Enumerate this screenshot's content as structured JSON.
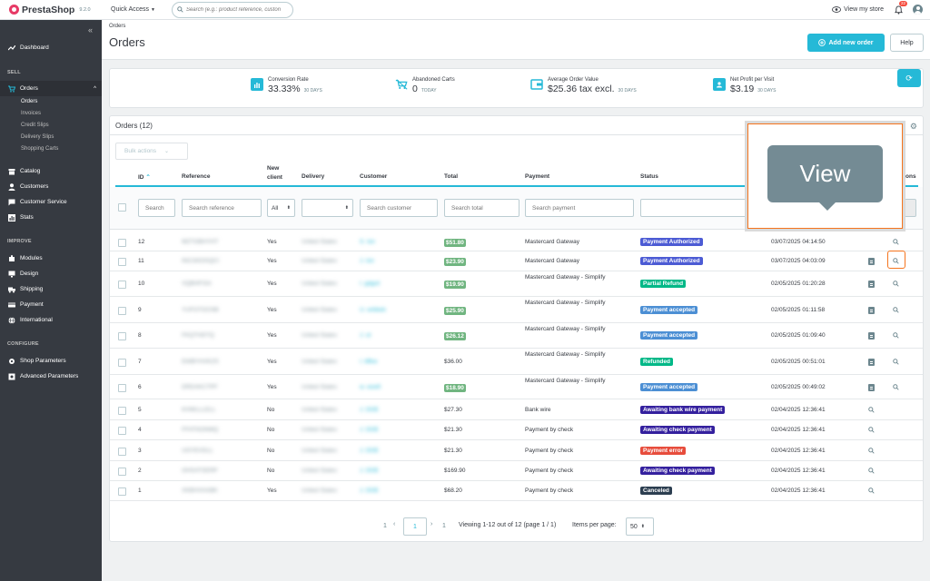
{
  "app": {
    "name": "PrestaShop",
    "version": "9.2.0",
    "quick_access": "Quick Access",
    "search_placeholder": "Search (e.g.: product reference, custon",
    "view_store": "View my store",
    "notifications": "22"
  },
  "sidebar": {
    "dashboard": "Dashboard",
    "section_sell": "SELL",
    "orders": "Orders",
    "orders_sub": [
      "Orders",
      "Invoices",
      "Credit Slips",
      "Delivery Slips",
      "Shopping Carts"
    ],
    "catalog": "Catalog",
    "customers": "Customers",
    "customer_service": "Customer Service",
    "stats": "Stats",
    "section_improve": "IMPROVE",
    "modules": "Modules",
    "design": "Design",
    "shipping": "Shipping",
    "payment": "Payment",
    "international": "International",
    "section_configure": "CONFIGURE",
    "shop_parameters": "Shop Parameters",
    "advanced_parameters": "Advanced Parameters"
  },
  "header": {
    "breadcrumb": "Orders",
    "title": "Orders",
    "add_button": "Add new order",
    "help_button": "Help"
  },
  "kpi": [
    {
      "label": "Conversion Rate",
      "value": "33.33%",
      "sub": "30 DAYS"
    },
    {
      "label": "Abandoned Carts",
      "value": "0",
      "sub": "TODAY"
    },
    {
      "label": "Average Order Value",
      "value": "$25.36 tax excl.",
      "sub": "30 DAYS"
    },
    {
      "label": "Net Profit per Visit",
      "value": "$3.19",
      "sub": "30 DAYS"
    }
  ],
  "orders": {
    "title": "Orders (12)",
    "bulk_actions": "Bulk actions",
    "columns": {
      "id": "ID",
      "reference": "Reference",
      "new_client_1": "New",
      "new_client_2": "client",
      "delivery": "Delivery",
      "customer": "Customer",
      "total": "Total",
      "payment": "Payment",
      "status": "Status",
      "actions": "ons"
    },
    "filters": {
      "id": "Search",
      "reference": "Search reference",
      "new_client": "All",
      "customer": "Search customer",
      "total": "Search total",
      "payment": "Search payment"
    },
    "rows": [
      {
        "id": "12",
        "reference": "MZTGBHYHT",
        "new_client": "Yes",
        "delivery": "United States",
        "customer": "S. Ion",
        "total": "$51.80",
        "total_badge": true,
        "payment": "Mastercard Gateway",
        "payment2": "",
        "status": "Payment Authorized",
        "status_color": "#4c5bd4",
        "date": "03/07/2025 04:14:50"
      },
      {
        "id": "11",
        "reference": "INCGKDSQCI",
        "new_client": "Yes",
        "delivery": "United States",
        "customer": "J. Ion",
        "total": "$23.90",
        "total_badge": true,
        "payment": "Mastercard Gateway",
        "payment2": "",
        "status": "Payment Authorized",
        "status_color": "#4c5bd4",
        "date": "03/07/2025 04:03:09"
      },
      {
        "id": "10",
        "reference": "VQBHFISA",
        "new_client": "Yes",
        "delivery": "United States",
        "customer": "I. gdgrd",
        "total": "$19.90",
        "total_badge": true,
        "payment": "Mastercard Gateway - Simplify",
        "payment2": "",
        "status": "Partial Refund",
        "status_color": "#01b887",
        "date": "02/05/2025 01:20:28"
      },
      {
        "id": "9",
        "reference": "YUFGTOCNB",
        "new_client": "Yes",
        "delivery": "United States",
        "customer": "U. wrbkek",
        "total": "$25.90",
        "total_badge": true,
        "payment": "Mastercard Gateway - Simplify",
        "payment2": "",
        "status": "Payment accepted",
        "status_color": "#4c8fd4",
        "date": "02/05/2025 01:11:58"
      },
      {
        "id": "8",
        "reference": "FKQTHDTQ",
        "new_client": "Yes",
        "delivery": "United States",
        "customer": "J. ot",
        "total": "$26.12",
        "total_badge": true,
        "payment": "Mastercard Gateway - Simplify",
        "payment2": "",
        "status": "Payment accepted",
        "status_color": "#4c8fd4",
        "date": "02/05/2025 01:09:40"
      },
      {
        "id": "7",
        "reference": "EWBYHVKZS",
        "new_client": "Yes",
        "delivery": "United States",
        "customer": "I. lilfkw",
        "total": "$36.00",
        "total_badge": false,
        "payment": "Mastercard Gateway - Simplify",
        "payment2": "",
        "status": "Refunded",
        "status_color": "#01b887",
        "date": "02/05/2025 00:51:01"
      },
      {
        "id": "6",
        "reference": "DRDAKCTPF",
        "new_client": "Yes",
        "delivery": "United States",
        "customer": "w. woefi",
        "total": "$18.90",
        "total_badge": true,
        "payment": "Mastercard Gateway - Simplify",
        "payment2": "",
        "status": "Payment accepted",
        "status_color": "#4c8fd4",
        "date": "02/05/2025 00:49:02"
      },
      {
        "id": "5",
        "reference": "KHWLLLELL",
        "new_client": "No",
        "delivery": "United States",
        "customer": "J. DOE",
        "total": "$27.30",
        "total_badge": false,
        "payment": "Bank wire",
        "payment2": "",
        "status": "Awaiting bank wire payment",
        "status_color": "#34209e",
        "date": "02/04/2025 12:36:41"
      },
      {
        "id": "4",
        "reference": "FFATNONMQ",
        "new_client": "No",
        "delivery": "United States",
        "customer": "J. DOE",
        "total": "$21.30",
        "total_badge": false,
        "payment": "Payment by check",
        "payment2": "",
        "status": "Awaiting check payment",
        "status_color": "#34209e",
        "date": "02/04/2025 12:36:41"
      },
      {
        "id": "3",
        "reference": "UOYEVDLL",
        "new_client": "No",
        "delivery": "United States",
        "customer": "J. DOE",
        "total": "$21.30",
        "total_badge": false,
        "payment": "Payment by check",
        "payment2": "",
        "status": "Payment error",
        "status_color": "#e74c3c",
        "date": "02/04/2025 12:36:41"
      },
      {
        "id": "2",
        "reference": "OHSATSERP",
        "new_client": "No",
        "delivery": "United States",
        "customer": "J. DOE",
        "total": "$169.90",
        "total_badge": false,
        "payment": "Payment by check",
        "payment2": "",
        "status": "Awaiting check payment",
        "status_color": "#34209e",
        "date": "02/04/2025 12:36:41"
      },
      {
        "id": "1",
        "reference": "XKBHVHABK",
        "new_client": "Yes",
        "delivery": "United States",
        "customer": "J. DOE",
        "total": "$68.20",
        "total_badge": false,
        "payment": "Payment by check",
        "payment2": "",
        "status": "Canceled",
        "status_color": "#2c3e50",
        "date": "02/04/2025 12:36:41"
      }
    ],
    "pagination": {
      "first": "1",
      "current": "1",
      "last": "1",
      "viewing": "Viewing 1-12 out of 12 (page 1 / 1)",
      "items_per_page_label": "Items per page:",
      "items_per_page": "50"
    }
  },
  "tooltip": {
    "text": "View"
  },
  "colors": {
    "primary": "#25b9d7",
    "sidebar": "#363a41",
    "highlight": "#f5741d",
    "tooltip": "#748b94"
  }
}
